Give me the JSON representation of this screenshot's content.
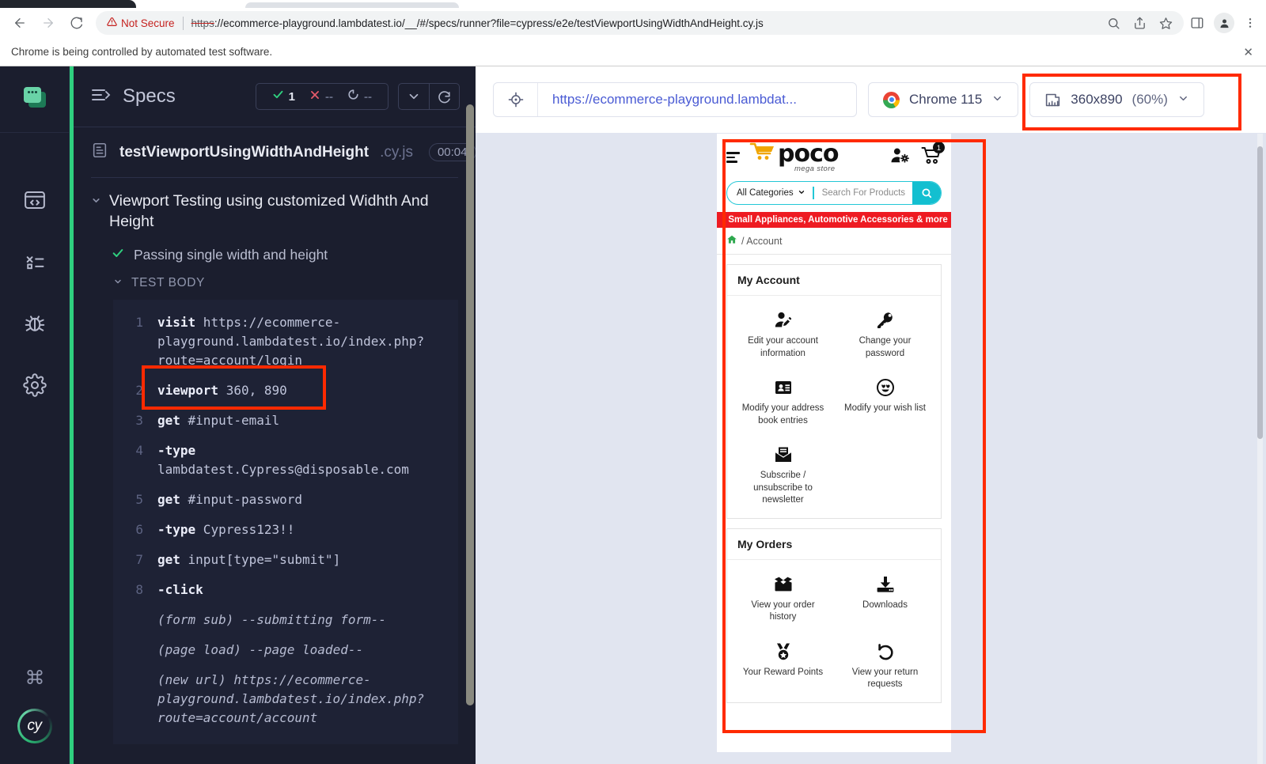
{
  "browser": {
    "security_label": "Not Secure",
    "url_scheme": "https",
    "url_rest": "://ecommerce-playground.lambdatest.io/__/#/specs/runner?file=cypress/e2e/testViewportUsingWidthAndHeight.cy.js",
    "infobar_text": "Chrome is being controlled by automated test software."
  },
  "reporter": {
    "title": "Specs",
    "stats": {
      "passed": "1",
      "failed": "--",
      "pending": "--"
    },
    "spec_name": "testViewportUsingWidthAndHeight",
    "spec_ext": ".cy.js",
    "spec_time": "00:04",
    "suite_title": "Viewport Testing using customized Widhth And Height",
    "test_title": "Passing single width and height",
    "test_body_label": "TEST BODY",
    "commands": [
      {
        "num": "1",
        "name": "visit",
        "arg": "https://ecommerce-playground.lambdatest.io/index.php?route=account/login"
      },
      {
        "num": "2",
        "name": "viewport",
        "arg": "360, 890"
      },
      {
        "num": "3",
        "name": "get",
        "arg": "#input-email"
      },
      {
        "num": "4",
        "name": "-type",
        "arg": "lambdatest.Cypress@disposable.com"
      },
      {
        "num": "5",
        "name": "get",
        "arg": "#input-password"
      },
      {
        "num": "6",
        "name": "-type",
        "arg": "Cypress123!!"
      },
      {
        "num": "7",
        "name": "get",
        "arg": "input[type=\"submit\"]"
      },
      {
        "num": "8",
        "name": "-click",
        "arg": ""
      }
    ],
    "messages": [
      {
        "label": "(form sub)",
        "text": "--submitting form--"
      },
      {
        "label": "(page load)",
        "text": "--page loaded--"
      },
      {
        "label": "(new url)",
        "text": "https://ecommerce-playground.lambdatest.io/index.php?route=account/account"
      }
    ]
  },
  "aut_toolbar": {
    "url": "https://ecommerce-playground.lambdat...",
    "browser_label": "Chrome 115",
    "viewport_size": "360x890",
    "viewport_scale": "(60%)"
  },
  "store": {
    "brand": "poco",
    "brand_sub": "mega store",
    "category_label": "All Categories",
    "search_placeholder": "Search For Products",
    "promo_text": ", Small Appliances, Automotive Accessories & more",
    "cart_count": "1",
    "breadcrumb_current": "/ Account",
    "sections": [
      {
        "title": "My Account",
        "tiles": [
          {
            "icon": "user-edit-icon",
            "label": "Edit your account information"
          },
          {
            "icon": "key-icon",
            "label": "Change your password"
          },
          {
            "icon": "address-book-icon",
            "label": "Modify your address book entries"
          },
          {
            "icon": "smiley-heart-eyes-icon",
            "label": "Modify your wish list"
          },
          {
            "icon": "newsletter-envelope-icon",
            "label": "Subscribe / unsubscribe to newsletter"
          }
        ]
      },
      {
        "title": "My Orders",
        "tiles": [
          {
            "icon": "open-box-icon",
            "label": "View your order history"
          },
          {
            "icon": "download-icon",
            "label": "Downloads"
          },
          {
            "icon": "reward-medal-icon",
            "label": "Your Reward Points"
          },
          {
            "icon": "return-arrow-icon",
            "label": "View your return requests"
          }
        ]
      }
    ]
  },
  "colors": {
    "cypress_green": "#2fd07f",
    "reporter_bg": "#1b1e2e",
    "annotation_red": "#ff2a00",
    "store_teal": "#13bfd0",
    "store_red": "#ee1b22"
  }
}
